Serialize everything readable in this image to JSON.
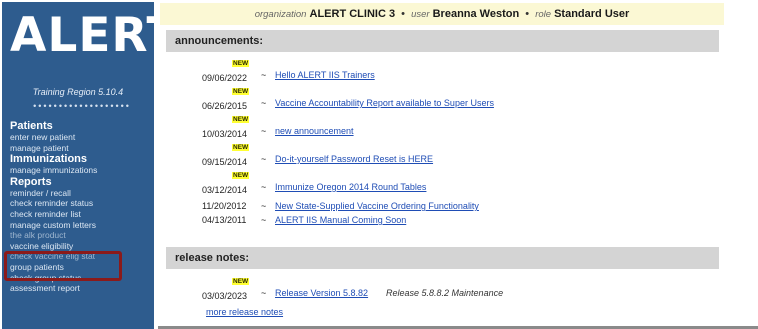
{
  "app": {
    "logo": "ALERT",
    "region": "Training Region 5.10.4",
    "dots": "•••••••••••••••••••"
  },
  "topbar": {
    "org_label": "organization",
    "org_value": "ALERT CLINIC 3",
    "user_label": "user",
    "user_value": "Breanna Weston",
    "role_label": "role",
    "role_value": "Standard User",
    "separator": "•"
  },
  "sidebar": {
    "sections": [
      {
        "title": "Patients",
        "items": [
          "enter new patient",
          "manage patient"
        ]
      },
      {
        "title": "Immunizations",
        "items": [
          "manage immunizations"
        ]
      },
      {
        "title": "Reports",
        "items": [
          "reminder / recall",
          "check reminder status",
          "check reminder list",
          "manage custom letters",
          "the alk product",
          "vaccine eligibility",
          "check vaccine elig stat",
          "group patients",
          "check group status",
          "assessment report"
        ]
      }
    ]
  },
  "announcements": {
    "header": "announcements:",
    "new_badge": "NEW",
    "tilde": "~",
    "items": [
      {
        "date": "09/06/2022",
        "title": "Hello ALERT IIS Trainers",
        "is_new": true
      },
      {
        "date": "06/26/2015",
        "title": "Vaccine Accountability Report available to Super Users",
        "is_new": true
      },
      {
        "date": "10/03/2014",
        "title": "new announcement",
        "is_new": true
      },
      {
        "date": "09/15/2014",
        "title": "Do-it-yourself Password Reset is HERE",
        "is_new": true
      },
      {
        "date": "03/12/2014",
        "title": "Immunize Oregon 2014 Round Tables",
        "is_new": true
      },
      {
        "date": "11/20/2012",
        "title": "New State-Supplied Vaccine Ordering Functionality",
        "is_new": false
      },
      {
        "date": "04/13/2011",
        "title": "ALERT IIS Manual Coming Soon",
        "is_new": false
      }
    ]
  },
  "release_notes": {
    "header": "release notes:",
    "new_badge": "NEW",
    "date": "03/03/2023",
    "tilde": "~",
    "link": "Release Version 5.8.82",
    "note": "Release 5.8.8.2 Maintenance",
    "more_link": "more release notes"
  },
  "colors": {
    "sidebar_bg": "#2e5c8e",
    "topbar_bg": "#fbf8d4",
    "section_bg": "#d4d4d4",
    "link": "#1f4db5",
    "new_badge_bg": "#ffff33",
    "highlight": "#8b1a1a"
  }
}
